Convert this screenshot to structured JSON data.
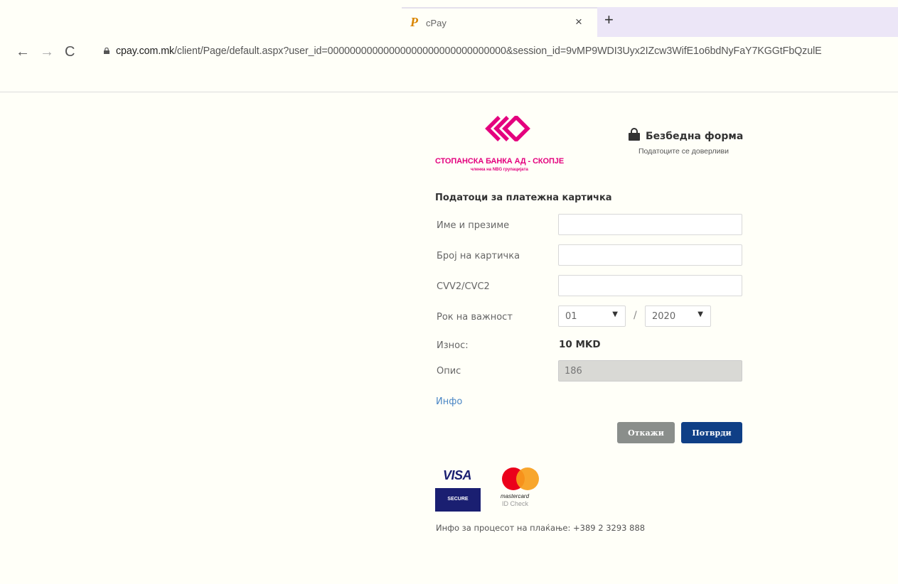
{
  "browser": {
    "tab_title": "cPay",
    "tab_favicon": "P",
    "tab_close": "×",
    "new_tab": "+",
    "nav": {
      "back": "←",
      "forward": "→",
      "reload": "C"
    },
    "url_host": "cpay.com.mk",
    "url_path": "/client/Page/default.aspx?user_id=00000000000000000000000000000000&session_id=9vMP9WDI3Uyx2IZcw3WifE1o6bdNyFaY7KGGtFbQzulE"
  },
  "bank": {
    "name": "СТОПАНСКА БАНКА АД - СКОПЈЕ",
    "subtitle": "членка на NBG групацијата",
    "brand_color": "#e4007e"
  },
  "secure": {
    "title": "Безбедна форма",
    "subtitle": "Податоците се доверливи"
  },
  "form": {
    "section_title": "Податоци за платежна картичка",
    "name_label": "Име и презиме",
    "name_value": "",
    "card_label": "Број на картичка",
    "card_value": "",
    "cvv_label": "CVV2/CVC2",
    "cvv_value": "",
    "expiry_label": "Рок на важност",
    "expiry_month": "01",
    "expiry_separator": "/",
    "expiry_year": "2020",
    "amount_label": "Износ:",
    "amount_value": "10 MKD",
    "desc_label": "Опис",
    "desc_value": "186",
    "info_link": "Инфо"
  },
  "buttons": {
    "cancel": "Откажи",
    "confirm": "Потврди",
    "cancel_color": "#8a8e8b",
    "confirm_color": "#0f3f86"
  },
  "card_brands": {
    "visa_word": "VISA",
    "visa_secure": "SECURE",
    "mastercard_word": "mastercard",
    "mastercard_id": "ID Check"
  },
  "footer": {
    "info_text": "Инфо за процесот на плаќање: +389 2 3293 888"
  }
}
